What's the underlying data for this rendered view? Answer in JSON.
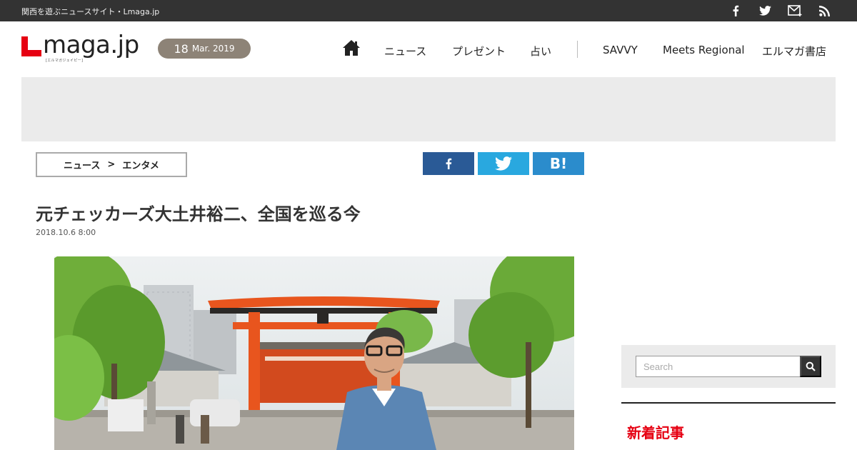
{
  "topbar": {
    "tagline": "関西を遊ぶニュースサイト・Lmaga.jp",
    "icons": [
      "facebook-icon",
      "twitter-icon",
      "mail-icon",
      "rss-icon"
    ]
  },
  "header": {
    "logo_text": "maga.jp",
    "logo_sub": "[エルマガジェイピー]",
    "date": {
      "day": "18",
      "month_year": "Mar. 2019"
    },
    "nav": {
      "home_icon": "home-icon",
      "items": [
        "ニュース",
        "プレゼント",
        "占い",
        "SAVVY",
        "Meets Regional",
        "エルマガ書店"
      ]
    }
  },
  "breadcrumb": {
    "items": [
      "ニュース",
      "エンタメ"
    ],
    "separator": ">"
  },
  "share": {
    "facebook": "f",
    "twitter": "twitter-icon",
    "hatena": "B!"
  },
  "article": {
    "title": "元チェッカーズ大土井裕二、全国を巡る今",
    "date": "2018.10.6 8:00"
  },
  "sidebar": {
    "search_placeholder": "Search",
    "new_articles_heading": "新着記事"
  },
  "colors": {
    "topbar": "#333333",
    "brand_red": "#e60012",
    "date_pill": "#8d8377",
    "facebook": "#2a5a96",
    "twitter": "#29a8df",
    "hatena": "#2b8ccc"
  }
}
